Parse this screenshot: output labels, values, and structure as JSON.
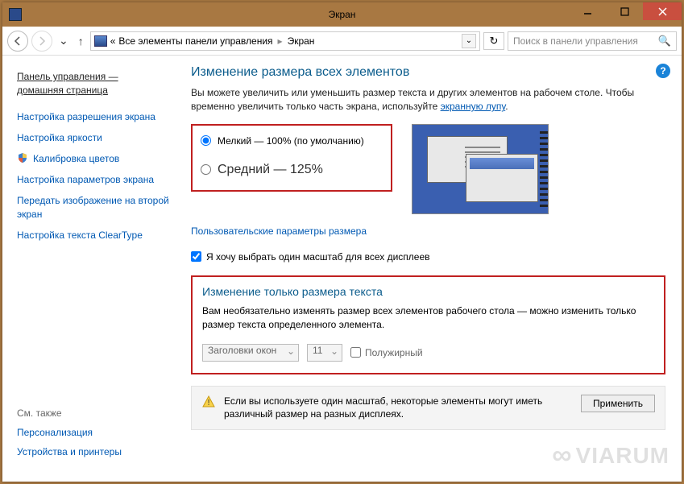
{
  "window": {
    "title": "Экран"
  },
  "toolbar": {
    "crumb_prefix": "«",
    "crumb1": "Все элементы панели управления",
    "crumb2": "Экран",
    "search_placeholder": "Поиск в панели управления"
  },
  "sidebar": {
    "home_line1": "Панель управления —",
    "home_line2": "домашняя страница",
    "links": [
      "Настройка разрешения экрана",
      "Настройка яркости",
      "Калибровка цветов",
      "Настройка параметров экрана",
      "Передать изображение на второй экран",
      "Настройка текста ClearType"
    ],
    "seealso_label": "См. также",
    "seealso_links": [
      "Персонализация",
      "Устройства и принтеры"
    ]
  },
  "main": {
    "heading": "Изменение размера всех элементов",
    "description_pre": "Вы можете увеличить или уменьшить размер текста и других элементов на рабочем столе. Чтобы временно увеличить только часть экрана, используйте ",
    "description_link": "экранную лупу",
    "radios": {
      "small": "Мелкий — 100% (по умолчанию)",
      "medium": "Средний — 125%"
    },
    "custom_link": "Пользовательские параметры размера",
    "checkbox_label": "Я хочу выбрать один масштаб для всех дисплеев",
    "textsize_heading": "Изменение только размера текста",
    "textsize_desc": "Вам необязательно изменять размер всех элементов рабочего стола — можно изменить только размер текста определенного элемента.",
    "element_select": "Заголовки окон",
    "size_select": "11",
    "bold_label": "Полужирный",
    "warning_text": "Если вы используете один масштаб, некоторые элементы могут иметь различный размер на разных дисплеях.",
    "apply_label": "Применить"
  },
  "watermark": "VIARUM"
}
